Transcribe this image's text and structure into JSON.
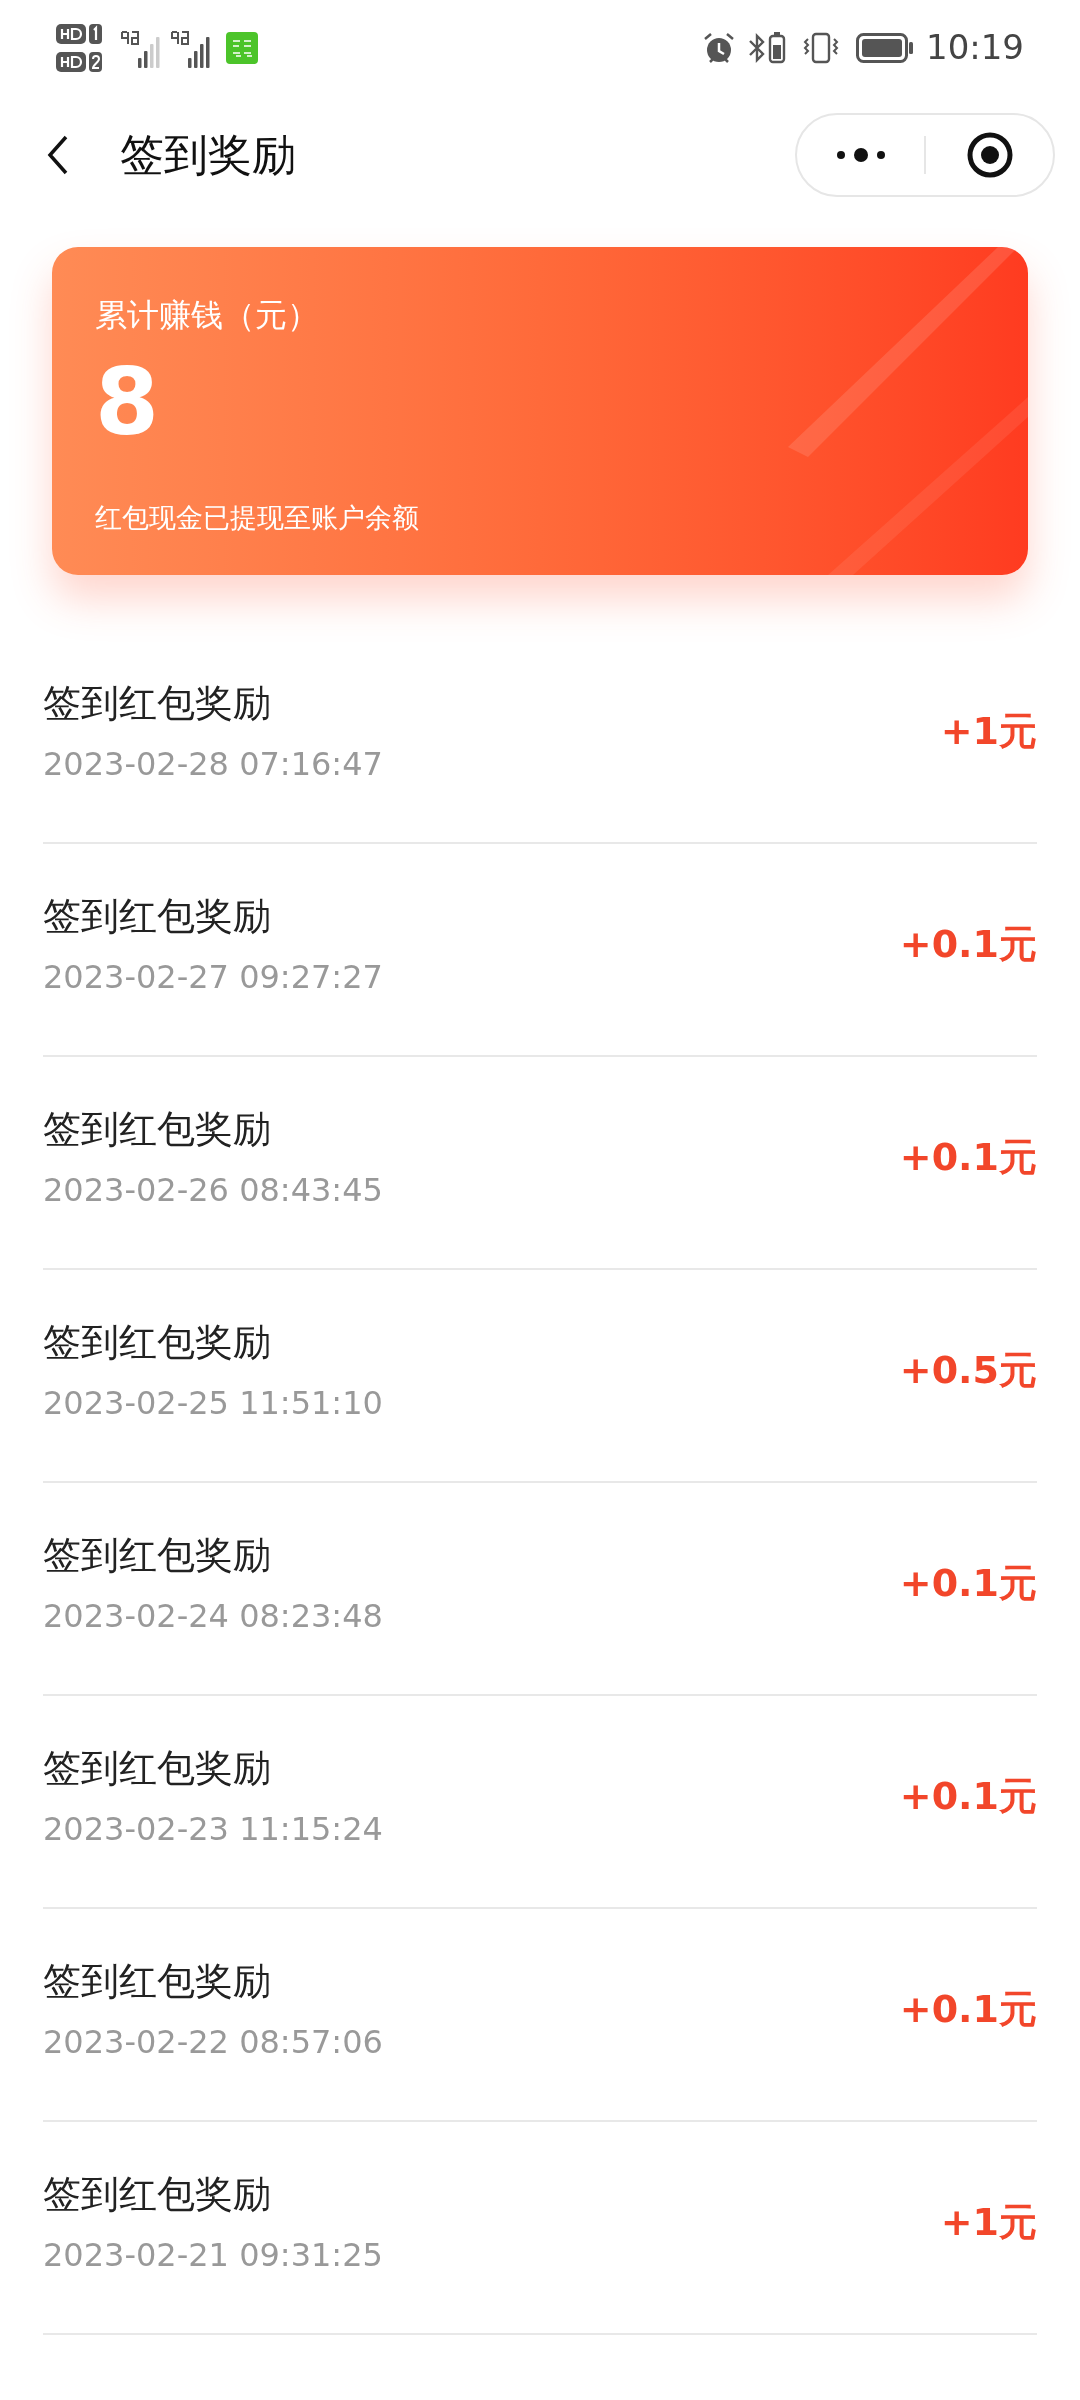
{
  "status_bar": {
    "time": "10:19"
  },
  "header": {
    "title": "签到奖励"
  },
  "summary": {
    "label": "累计赚钱（元）",
    "amount": "8",
    "note": "红包现金已提现至账户余额"
  },
  "records": [
    {
      "title": "签到红包奖励",
      "time": "2023-02-28 07:16:47",
      "amount": "+1元"
    },
    {
      "title": "签到红包奖励",
      "time": "2023-02-27 09:27:27",
      "amount": "+0.1元"
    },
    {
      "title": "签到红包奖励",
      "time": "2023-02-26 08:43:45",
      "amount": "+0.1元"
    },
    {
      "title": "签到红包奖励",
      "time": "2023-02-25 11:51:10",
      "amount": "+0.5元"
    },
    {
      "title": "签到红包奖励",
      "time": "2023-02-24 08:23:48",
      "amount": "+0.1元"
    },
    {
      "title": "签到红包奖励",
      "time": "2023-02-23 11:15:24",
      "amount": "+0.1元"
    },
    {
      "title": "签到红包奖励",
      "time": "2023-02-22 08:57:06",
      "amount": "+0.1元"
    },
    {
      "title": "签到红包奖励",
      "time": "2023-02-21 09:31:25",
      "amount": "+1元"
    }
  ]
}
